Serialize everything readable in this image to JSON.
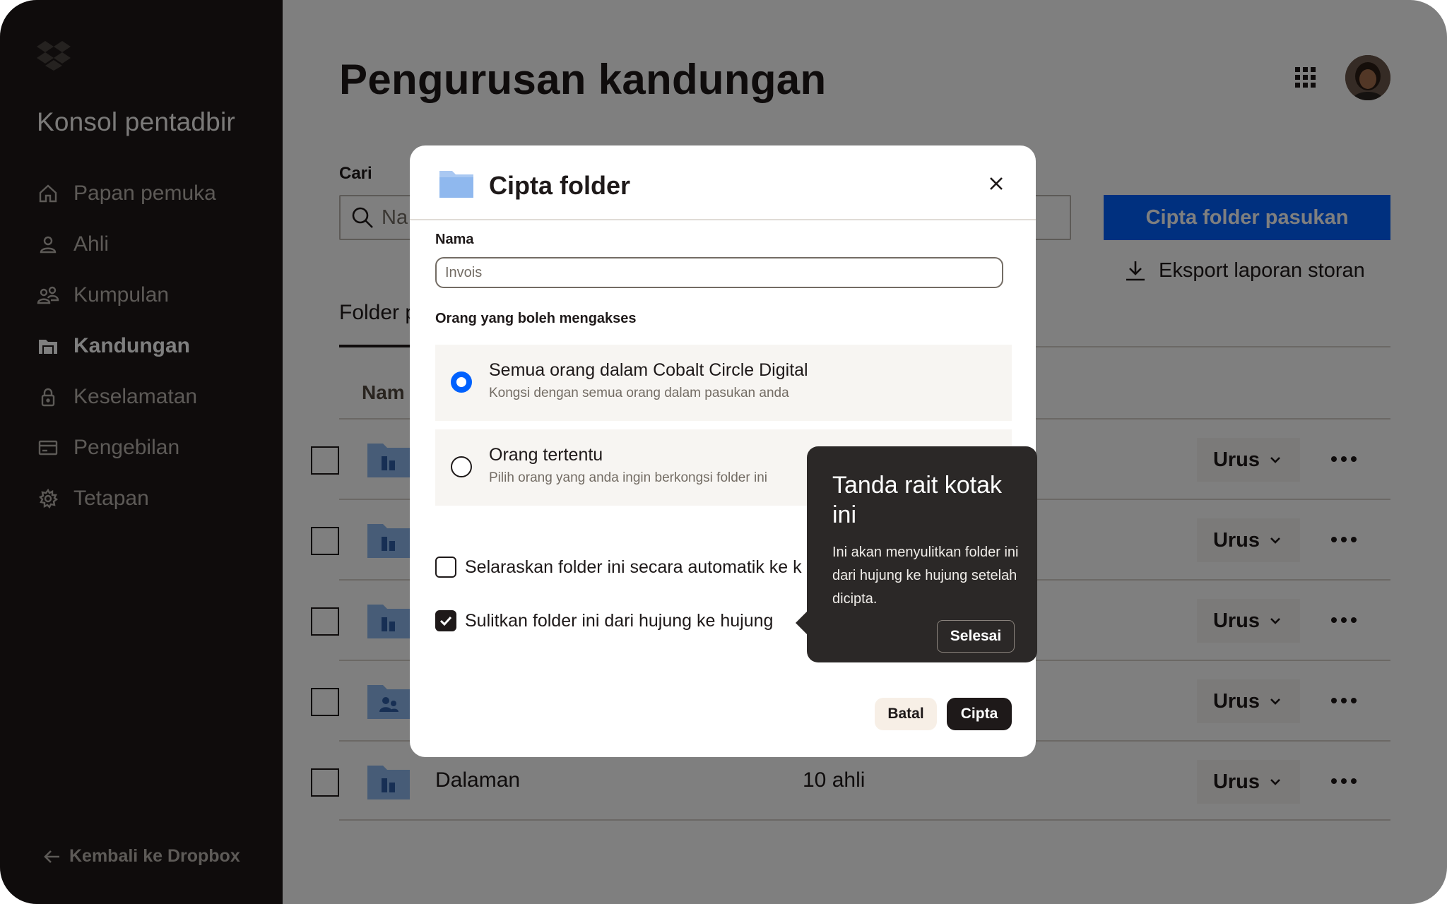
{
  "sidebar": {
    "title": "Konsol pentadbir",
    "items": [
      {
        "label": "Papan pemuka",
        "icon": "home-icon"
      },
      {
        "label": "Ahli",
        "icon": "person-icon"
      },
      {
        "label": "Kumpulan",
        "icon": "group-icon"
      },
      {
        "label": "Kandungan",
        "icon": "content-icon",
        "active": true
      },
      {
        "label": "Keselamatan",
        "icon": "lock-icon"
      },
      {
        "label": "Pengebilan",
        "icon": "billing-icon"
      },
      {
        "label": "Tetapan",
        "icon": "gear-icon"
      }
    ],
    "back_label": "Kembali ke Dropbox"
  },
  "header": {
    "title": "Pengurusan kandungan"
  },
  "search": {
    "label": "Cari",
    "placeholder": "Na"
  },
  "actions": {
    "create_team_folder": "Cipta folder pasukan",
    "export_report": "Eksport laporan storan"
  },
  "tabs": [
    {
      "label": "Folder p"
    }
  ],
  "table": {
    "column_name": "Nam",
    "rows": [
      {
        "name": "",
        "members": "",
        "manage": "Urus"
      },
      {
        "name": "",
        "members": "",
        "manage": "Urus"
      },
      {
        "name": "",
        "members": "",
        "manage": "Urus"
      },
      {
        "name": "",
        "members": "",
        "manage": "Urus"
      },
      {
        "name": "Dalaman",
        "members": "10 ahli",
        "manage": "Urus"
      }
    ]
  },
  "modal": {
    "title": "Cipta folder",
    "name_label": "Nama",
    "name_placeholder": "Invois",
    "access_label": "Orang yang boleh mengakses",
    "options": [
      {
        "title": "Semua orang dalam Cobalt Circle Digital",
        "subtitle": "Kongsi dengan semua orang dalam pasukan anda",
        "selected": true
      },
      {
        "title": "Orang tertentu",
        "subtitle": "Pilih orang yang anda ingin berkongsi folder ini",
        "selected": false
      }
    ],
    "checkboxes": [
      {
        "label": "Selaraskan folder ini secara automatik ke k",
        "checked": false
      },
      {
        "label": "Sulitkan folder ini dari hujung ke hujung",
        "checked": true
      }
    ],
    "cancel": "Batal",
    "create": "Cipta"
  },
  "tooltip": {
    "title": "Tanda rait kotak ini",
    "body": "Ini akan menyulitkan folder ini dari hujung ke hujung setelah dicipta.",
    "done": "Selesai"
  },
  "colors": {
    "accent": "#0061fe",
    "sidebar_bg": "#1e1919",
    "tooltip_bg": "#2b2827",
    "folder": "#8fb8ee"
  }
}
